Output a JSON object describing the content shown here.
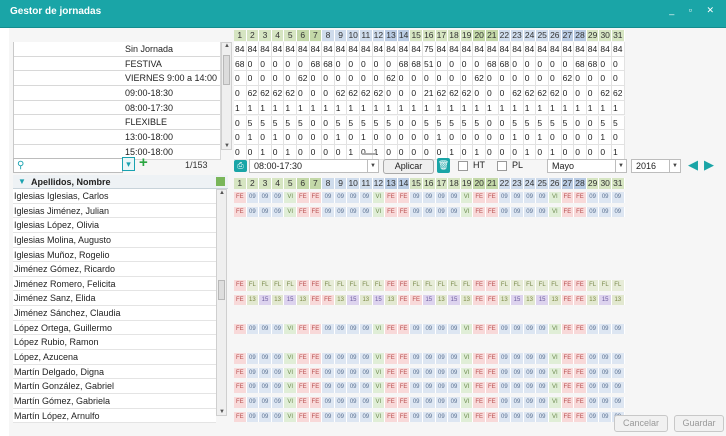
{
  "window": {
    "title": "Gestor de jornadas",
    "controls": "_ ▫ ✕"
  },
  "top_matrix": {
    "day_headers": [
      "1",
      "2",
      "3",
      "4",
      "5",
      "6",
      "7",
      "8",
      "9",
      "10",
      "11",
      "12",
      "13",
      "14",
      "15",
      "16",
      "17",
      "18",
      "19",
      "20",
      "21",
      "22",
      "23",
      "24",
      "25",
      "26",
      "27",
      "28",
      "29",
      "30",
      "31"
    ],
    "rows": [
      {
        "label": "Sin Jornada",
        "values": [
          "84",
          "84",
          "84",
          "84",
          "84",
          "84",
          "84",
          "84",
          "84",
          "84",
          "84",
          "84",
          "84",
          "84",
          "84",
          "75",
          "84",
          "84",
          "84",
          "84",
          "84",
          "84",
          "84",
          "84",
          "84",
          "84",
          "84",
          "84",
          "84",
          "84",
          "84"
        ]
      },
      {
        "label": "FESTIVA",
        "values": [
          "68",
          "0",
          "0",
          "0",
          "0",
          "0",
          "68",
          "68",
          "0",
          "0",
          "0",
          "0",
          "0",
          "68",
          "68",
          "51",
          "0",
          "0",
          "0",
          "0",
          "68",
          "68",
          "0",
          "0",
          "0",
          "0",
          "0",
          "68",
          "68",
          "0",
          "0"
        ]
      },
      {
        "label": "VIERNES 9:00 a 14:00",
        "values": [
          "0",
          "0",
          "0",
          "0",
          "0",
          "62",
          "0",
          "0",
          "0",
          "0",
          "0",
          "0",
          "62",
          "0",
          "0",
          "0",
          "0",
          "0",
          "0",
          "62",
          "0",
          "0",
          "0",
          "0",
          "0",
          "0",
          "62",
          "0",
          "0",
          "0",
          "0"
        ]
      },
      {
        "label": "09:00-18:30",
        "values": [
          "0",
          "62",
          "62",
          "62",
          "62",
          "0",
          "0",
          "0",
          "62",
          "62",
          "62",
          "62",
          "0",
          "0",
          "0",
          "21",
          "62",
          "62",
          "62",
          "0",
          "0",
          "0",
          "62",
          "62",
          "62",
          "62",
          "0",
          "0",
          "0",
          "62",
          "62"
        ]
      },
      {
        "label": "08:00-17:30",
        "values": [
          "1",
          "1",
          "1",
          "1",
          "1",
          "1",
          "1",
          "1",
          "1",
          "1",
          "1",
          "1",
          "1",
          "1",
          "1",
          "1",
          "1",
          "1",
          "1",
          "1",
          "1",
          "1",
          "1",
          "1",
          "1",
          "1",
          "1",
          "1",
          "1",
          "1",
          "1"
        ]
      },
      {
        "label": "FLEXIBLE",
        "values": [
          "0",
          "5",
          "5",
          "5",
          "5",
          "5",
          "0",
          "0",
          "5",
          "5",
          "5",
          "5",
          "5",
          "0",
          "0",
          "5",
          "5",
          "5",
          "5",
          "5",
          "0",
          "0",
          "5",
          "5",
          "5",
          "5",
          "5",
          "0",
          "0",
          "5",
          "5"
        ]
      },
      {
        "label": "13:00-18:00",
        "values": [
          "0",
          "1",
          "0",
          "1",
          "0",
          "0",
          "0",
          "0",
          "1",
          "0",
          "1",
          "0",
          "0",
          "0",
          "0",
          "0",
          "1",
          "0",
          "0",
          "0",
          "0",
          "0",
          "1",
          "0",
          "1",
          "0",
          "0",
          "0",
          "0",
          "1",
          "0"
        ]
      },
      {
        "label": "15:00-18:00",
        "values": [
          "0",
          "0",
          "1",
          "0",
          "1",
          "0",
          "0",
          "0",
          "0",
          "1",
          "0",
          "1",
          "0",
          "0",
          "0",
          "0",
          "0",
          "1",
          "0",
          "1",
          "0",
          "0",
          "0",
          "1",
          "0",
          "1",
          "0",
          "0",
          "0",
          "0",
          "1"
        ]
      }
    ]
  },
  "filter": {
    "counter": "1/153",
    "search_placeholder": ""
  },
  "list": {
    "header": "Apellidos, Nombre",
    "people": [
      "Iglesias Iglesias, Carlos",
      "Iglesias Jiménez, Julian",
      "Iglesias López, Olivia",
      "Iglesias Molina, Augusto",
      "Iglesias Muñoz, Rogelio",
      "Jiménez Gómez, Ricardo",
      "Jiménez Romero, Felicita",
      "Jiménez Sanz, Elida",
      "Jiménez Sánchez, Claudia",
      "López Ortega, Guillermo",
      "López Rubio, Ramon",
      "López, Azucena",
      "Martín Delgado, Digna",
      "Martín González, Gabriel",
      "Martín Gómez, Gabriela",
      "Martín López, Arnulfo"
    ]
  },
  "toolbar": {
    "schedule": "08:00-17:30",
    "apply_label": "Aplicar",
    "ht_label": "HT",
    "pl_label": "PL",
    "month": "Mayo",
    "year": "2016"
  },
  "schedule_grid": {
    "patterns": {
      "A": [
        "FE",
        "09",
        "09",
        "09",
        "VI",
        "FE",
        "FE",
        "09",
        "09",
        "09",
        "09",
        "VI",
        "FE",
        "FE",
        "09",
        "09",
        "09",
        "09",
        "VI",
        "FE",
        "FE",
        "09",
        "09",
        "09",
        "09",
        "VI",
        "FE",
        "FE",
        "09",
        "09",
        "09"
      ],
      "F": [
        "FE",
        "FL",
        "FL",
        "FL",
        "FL",
        "FE",
        "FE",
        "FL",
        "FL",
        "FL",
        "FL",
        "FL",
        "FE",
        "FE",
        "FL",
        "FL",
        "FL",
        "FL",
        "FL",
        "FE",
        "FE",
        "FL",
        "FL",
        "FL",
        "FL",
        "FL",
        "FE",
        "FE",
        "FL",
        "FL",
        "FL"
      ],
      "S": [
        "FE",
        "13",
        "15",
        "13",
        "15",
        "13",
        "FE",
        "FE",
        "13",
        "15",
        "13",
        "15",
        "13",
        "FE",
        "FE",
        "15",
        "13",
        "15",
        "13",
        "FE",
        "FE",
        "13",
        "15",
        "13",
        "15",
        "13",
        "FE",
        "FE",
        "13",
        "15",
        "13"
      ]
    },
    "rows": [
      "A",
      "A",
      "",
      "",
      "",
      "",
      "F",
      "S",
      "",
      "A",
      "",
      "A",
      "A",
      "A",
      "A",
      "A"
    ]
  },
  "footer": {
    "cancel_label": "Cancelar",
    "save_label": "Guardar"
  }
}
